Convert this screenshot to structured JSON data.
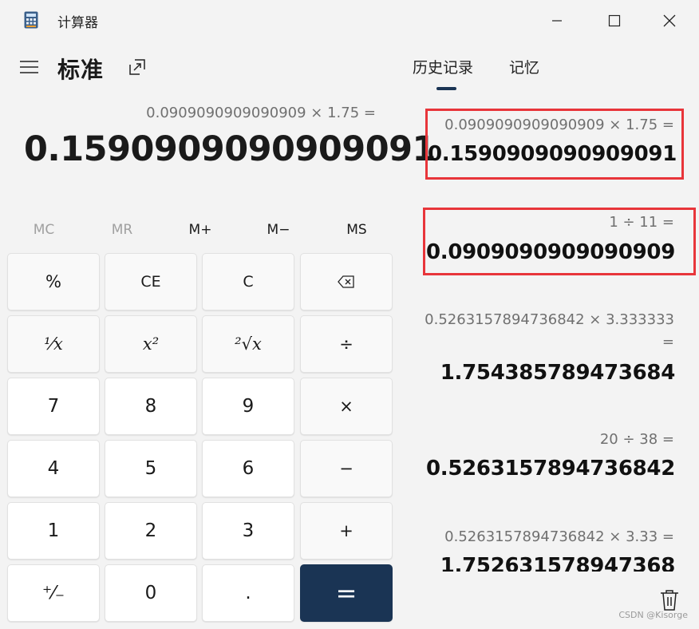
{
  "window": {
    "title": "计算器",
    "controls": {
      "minimize": "minimize-icon",
      "maximize": "maximize-icon",
      "close": "close-icon"
    }
  },
  "header": {
    "menu_icon": "hamburger-icon",
    "mode": "标准",
    "keep_on_top_icon": "keep-on-top-icon"
  },
  "panel_tabs": {
    "history": "历史记录",
    "memory": "记忆",
    "active": "history"
  },
  "display": {
    "expression": "0.0909090909090909 × 1.75 =",
    "result": "0.1590909090909091"
  },
  "memory_buttons": {
    "mc": "MC",
    "mr": "MR",
    "mplus": "M+",
    "mminus": "M−",
    "ms": "MS"
  },
  "keypad": {
    "percent": "%",
    "ce": "CE",
    "c": "C",
    "backspace_icon": "backspace-icon",
    "reciprocal": "¹⁄x",
    "square": "x²",
    "sqrt": "²√x",
    "divide": "÷",
    "multiply": "×",
    "subtract": "−",
    "add": "+",
    "negate": "⁺⁄₋",
    "decimal": ".",
    "equals": "=",
    "digits": {
      "0": "0",
      "1": "1",
      "2": "2",
      "3": "3",
      "4": "4",
      "5": "5",
      "6": "6",
      "7": "7",
      "8": "8",
      "9": "9"
    }
  },
  "history": [
    {
      "expression": "0.0909090909090909   ×   1.75 =",
      "result": "0.1590909090909091",
      "highlighted": true
    },
    {
      "expression": "1   ÷   11 =",
      "result": "0.0909090909090909",
      "highlighted": true
    },
    {
      "expression": "0.5263157894736842   ×   3.333333",
      "expression_cont": "=",
      "result": "1.754385789473684"
    },
    {
      "expression": "20   ÷   38 =",
      "result": "0.5263157894736842"
    },
    {
      "expression": "0.5263157894736842   ×   3.33 =",
      "result": "1.752631578947368"
    }
  ],
  "history_delete_icon": "trash-icon",
  "watermark": "CSDN @Kisorge",
  "colors": {
    "accent": "#1a3454",
    "highlight_box": "#e8353a",
    "background": "#f3f3f3"
  }
}
